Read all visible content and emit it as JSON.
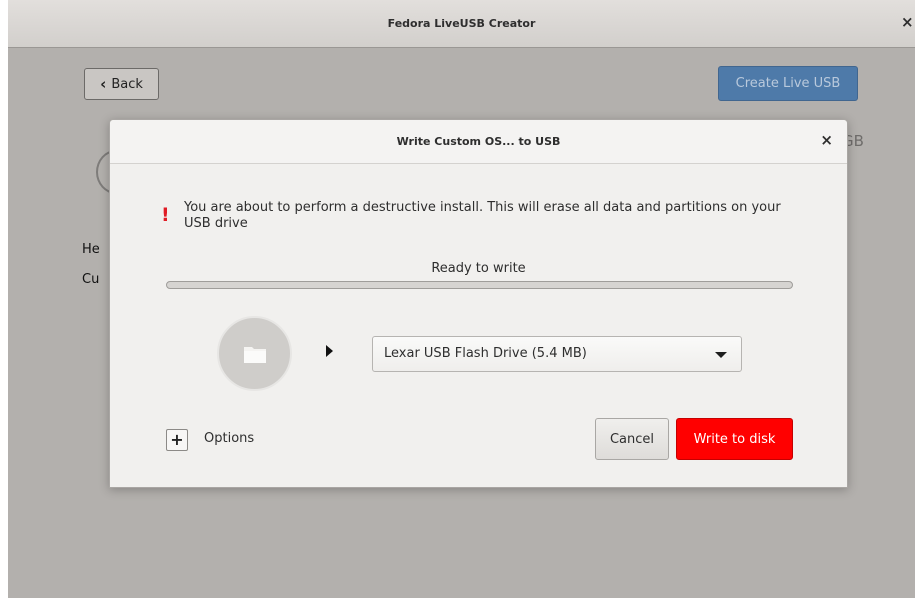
{
  "app": {
    "title": "Fedora LiveUSB Creator",
    "close_glyph": "×",
    "back_glyph": "‹",
    "back_label": "Back",
    "create_label": "Create Live USB",
    "bg_fragments": [
      "He",
      "Cu",
      "GB"
    ]
  },
  "dialog": {
    "title": "Write Custom OS... to USB",
    "close_glyph": "×",
    "warning_glyph": "!",
    "warning_text": "You are about to perform a destructive install. This will erase all data and partitions on your USB drive",
    "progress_label": "Ready to write",
    "progress_value": 0,
    "target_drive": "Lexar USB Flash Drive (5.4 MB)",
    "options_glyph": "+",
    "options_label": "Options",
    "cancel_label": "Cancel",
    "write_label": "Write to disk"
  },
  "icons": {
    "source": "folder-icon",
    "arrow": "play-arrow-icon",
    "dropdown": "chevron-down-icon"
  },
  "colors": {
    "accent_blue": "#4e7aa9",
    "danger_red": "#ff0000",
    "warning_red": "#e01b24"
  }
}
